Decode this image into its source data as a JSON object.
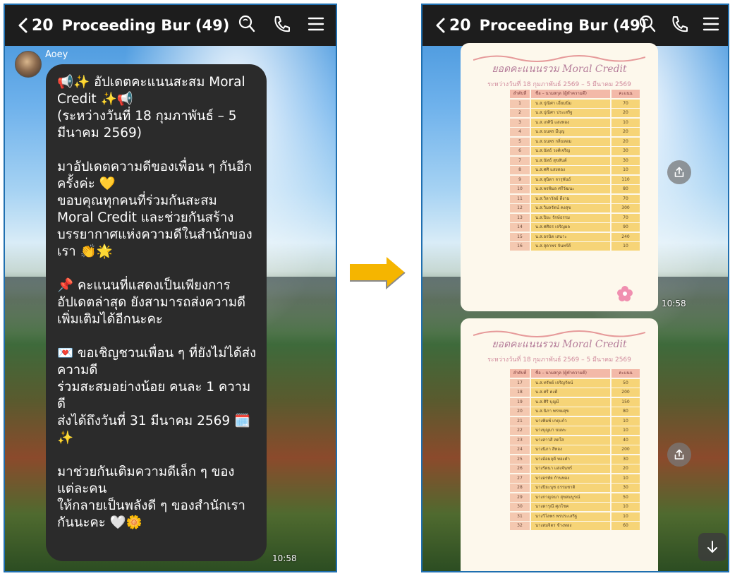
{
  "header": {
    "back_count": "20",
    "title": "Proceeding Bur (49)",
    "icons": [
      "search-icon",
      "phone-icon",
      "menu-icon"
    ]
  },
  "left": {
    "sender": "Aoey",
    "message": "📢✨ อัปเดตคะแนนสะสม Moral Credit ✨📢\n(ระหว่างวันที่ 18 กุมภาพันธ์ – 5 มีนาคม 2569)\n\nมาอัปเดตความดีของเพื่อน ๆ กันอีกครั้งค่ะ 💛\nขอบคุณทุกคนที่ร่วมกันสะสม Moral Credit และช่วยกันสร้างบรรยากาศแห่งความดีในสำนักของเรา 👏🌟\n\n📌 คะแนนที่แสดงเป็นเพียงการอัปเดตล่าสุด ยังสามารถส่งความดีเพิ่มเติมได้อีกนะคะ\n\n💌 ขอเชิญชวนเพื่อน ๆ ที่ยังไม่ได้ส่งความดี\nร่วมสะสมอย่างน้อย คนละ 1 ความดี\nส่งได้ถึงวันที่ 31 มีนาคม 2569 🗓️✨\n\nมาช่วยกันเติมความดีเล็ก ๆ ของแต่ละคน\nให้กลายเป็นพลังดี ๆ ของสำนักเรากันนะคะ 🤍🌼",
    "time": "10:58"
  },
  "right": {
    "time": "10:58",
    "card_title": "ยอดคะแนนรวม Moral Credit",
    "card_subtitle": "ระหว่างวันที่ 18 กุมภาพันธ์ 2569 – 5 มีนาคม 2569",
    "table_headers": [
      "ลำดับที่",
      "ชื่อ – นามสกุล (ผู้ทำความดี)",
      "คะแนน"
    ],
    "page1": {
      "rows": [
        {
          "no": "1",
          "name": "น.ส.ปุณิศา เอี่ยมนิ่ม",
          "score": "70"
        },
        {
          "no": "2",
          "name": "น.ส.ปุณิศา ประเสริฐ",
          "score": "20"
        },
        {
          "no": "3",
          "name": "น.ส.เกศินี แสงทอง",
          "score": "10"
        },
        {
          "no": "4",
          "name": "น.ส.ธนพร มีบุญ",
          "score": "20"
        },
        {
          "no": "5",
          "name": "น.ส.ธนพร กลิ่นหอม",
          "score": "20"
        },
        {
          "no": "6",
          "name": "น.ส.นัทธ์ วงศ์เจริญ",
          "score": "30"
        },
        {
          "no": "7",
          "name": "น.ส.นัทธ์ สุขสันต์",
          "score": "30"
        },
        {
          "no": "8",
          "name": "น.ส.ศศิ แสงทอง",
          "score": "10"
        },
        {
          "no": "9",
          "name": "น.ส.สุนิตา จารุพันธ์",
          "score": "110"
        },
        {
          "no": "10",
          "name": "น.ส.พรพิมล ศรีวัฒนะ",
          "score": "80"
        },
        {
          "no": "11",
          "name": "น.ส.วิลาวัลย์ ดีงาม",
          "score": "70"
        },
        {
          "no": "12",
          "name": "น.ส.วิมลรัตน์ คงสุข",
          "score": "300"
        },
        {
          "no": "13",
          "name": "น.ส.ปิยะ รักษ์ธรรม",
          "score": "70"
        },
        {
          "no": "14",
          "name": "น.ส.ศศิธร เจริญผล",
          "score": "90"
        },
        {
          "no": "15",
          "name": "น.ส.อรนิต เสนาะ",
          "score": "240"
        },
        {
          "no": "16",
          "name": "น.ส.สุดาพร จันทร์ดี",
          "score": "10"
        }
      ]
    },
    "page2": {
      "rows": [
        {
          "no": "17",
          "name": "น.ส.ทรัพย์ เจริญรัตน์",
          "score": "50"
        },
        {
          "no": "18",
          "name": "น.ส.ศรี คงดี",
          "score": "200"
        },
        {
          "no": "19",
          "name": "น.ส.ศิริ บุญมี",
          "score": "150"
        },
        {
          "no": "20",
          "name": "น.ส.นิภา พรหมสุข",
          "score": "80"
        },
        {
          "no": "21",
          "name": "นางพิมพ์ เกตุแก้ว",
          "score": "10"
        },
        {
          "no": "22",
          "name": "นางบุญมา นนทะ",
          "score": "10"
        },
        {
          "no": "23",
          "name": "นางสาวสี สดใส",
          "score": "40"
        },
        {
          "no": "24",
          "name": "นางนิภา สีทอง",
          "score": "200"
        },
        {
          "no": "25",
          "name": "นางอ้อมฤดี ทองคำ",
          "score": "30"
        },
        {
          "no": "26",
          "name": "นางรัตนา แสงจันทร์",
          "score": "20"
        },
        {
          "no": "27",
          "name": "นางอรทัย ก้านทอง",
          "score": "10"
        },
        {
          "no": "28",
          "name": "นางปิยะนุช ธรรมชาติ",
          "score": "30"
        },
        {
          "no": "29",
          "name": "นางกาญจนา สุขสมบูรณ์",
          "score": "50"
        },
        {
          "no": "30",
          "name": "นางดารุณี ศุภโชค",
          "score": "10"
        },
        {
          "no": "31",
          "name": "นางวิไลพร พรประเสริฐ",
          "score": "10"
        },
        {
          "no": "32",
          "name": "นางสมจิตร ช้างทอง",
          "score": "60"
        }
      ]
    }
  },
  "colors": {
    "accent_arrow": "#f5b500",
    "header_bg": "#1d1d1d",
    "bubble_bg": "#2b2b2b",
    "card_bg": "#fdf8ec",
    "table_fill": "#f6d477",
    "title_pink": "#b57d9a"
  }
}
